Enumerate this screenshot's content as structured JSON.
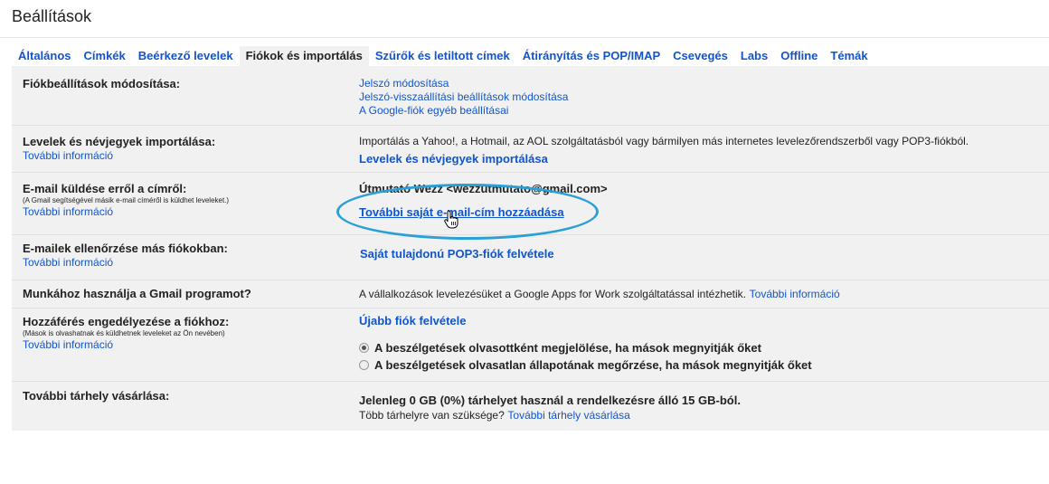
{
  "page": {
    "title": "Beállítások"
  },
  "tabs": [
    {
      "label": "Általános",
      "active": false
    },
    {
      "label": "Címkék",
      "active": false
    },
    {
      "label": "Beérkező levelek",
      "active": false
    },
    {
      "label": "Fiókok és importálás",
      "active": true
    },
    {
      "label": "Szűrők és letiltott címek",
      "active": false
    },
    {
      "label": "Átirányítás és POP/IMAP",
      "active": false
    },
    {
      "label": "Csevegés",
      "active": false
    },
    {
      "label": "Labs",
      "active": false
    },
    {
      "label": "Offline",
      "active": false
    },
    {
      "label": "Témák",
      "active": false
    }
  ],
  "rows": {
    "account": {
      "label": "Fiókbeállítások módosítása:",
      "links": [
        "Jelszó módosítása",
        "Jelszó-visszaállítási beállítások módosítása",
        "A Google-fiók egyéb beállításai"
      ]
    },
    "import": {
      "label": "Levelek és névjegyek importálása:",
      "more": "További információ",
      "desc": "Importálás a Yahoo!, a Hotmail, az AOL szolgáltatásból vagy bármilyen más internetes levelezőrendszerből vagy POP3-fiókból.",
      "action": "Levelek és névjegyek importálása"
    },
    "sendas": {
      "label": "E-mail küldése erről a címről:",
      "note": "(A Gmail segítségével másik e-mail címéről is küldhet leveleket.)",
      "more": "További információ",
      "address": "Útmutató Wezz <wezzutmutato@gmail.com>",
      "action": "További saját e-mail-cím hozzáadása"
    },
    "check": {
      "label": "E-mailek ellenőrzése más fiókokban:",
      "more": "További információ",
      "action": "Saját tulajdonú POP3-fiók felvétele"
    },
    "work": {
      "label": "Munkához használja a Gmail programot?",
      "desc": "A vállalkozások levelezésüket a Google Apps for Work szolgáltatással intézhetik.",
      "more": "További információ"
    },
    "grant": {
      "label": "Hozzáférés engedélyezése a fiókhoz:",
      "note": "(Mások is olvashatnak és küldhetnek leveleket az Ön nevében)",
      "more": "További információ",
      "action": "Újabb fiók felvétele",
      "options": [
        {
          "label": "A beszélgetések olvasottként megjelölése, ha mások megnyitják őket",
          "checked": true
        },
        {
          "label": "A beszélgetések olvasatlan állapotának megőrzése, ha mások megnyitják őket",
          "checked": false
        }
      ]
    },
    "storage": {
      "label": "További tárhely vásárlása:",
      "usage": "Jelenleg 0 GB (0%) tárhelyet használ a rendelkezésre álló 15 GB-ból.",
      "question": "Több tárhelyre van szüksége?",
      "action": "További tárhely vásárlása"
    }
  },
  "colors": {
    "link": "#1155cc",
    "highlight": "#2aa0d6",
    "panel": "#f1f1f1"
  },
  "cursor": "hand-pointer-icon"
}
